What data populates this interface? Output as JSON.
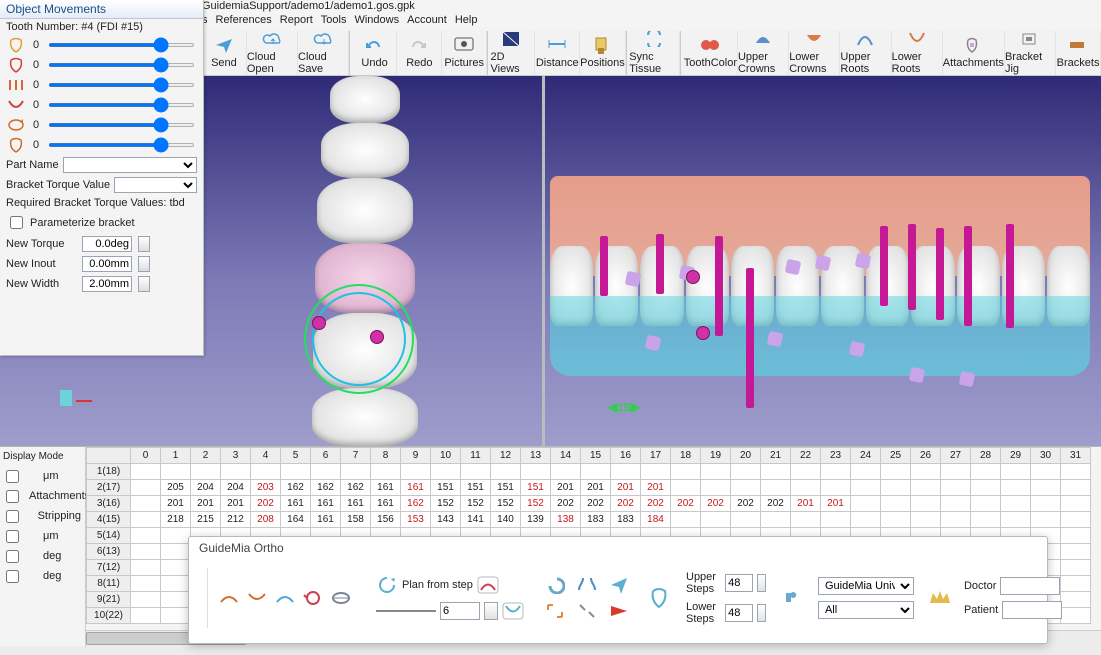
{
  "window": {
    "title_path": "GuidemiaSupport/ademo1/ademo1.gos.gpk"
  },
  "menus": [
    "s",
    "References",
    "Report",
    "Tools",
    "Windows",
    "Account",
    "Help"
  ],
  "toolbar": [
    {
      "id": "send",
      "label": "Send"
    },
    {
      "id": "cloud-open",
      "label": "Cloud Open"
    },
    {
      "id": "cloud-save",
      "label": "Cloud Save"
    },
    {
      "id": "undo",
      "label": "Undo"
    },
    {
      "id": "redo",
      "label": "Redo"
    },
    {
      "id": "pictures",
      "label": "Pictures"
    },
    {
      "id": "2d-views",
      "label": "2D Views"
    },
    {
      "id": "distance",
      "label": "Distance"
    },
    {
      "id": "positions",
      "label": "Positions"
    },
    {
      "id": "sync-tissue",
      "label": "Sync Tissue"
    },
    {
      "id": "tooth-color",
      "label": "ToothColor"
    },
    {
      "id": "upper-crowns",
      "label": "Upper Crowns"
    },
    {
      "id": "lower-crowns",
      "label": "Lower Crowns"
    },
    {
      "id": "upper-roots",
      "label": "Upper Roots"
    },
    {
      "id": "lower-roots",
      "label": "Lower Roots"
    },
    {
      "id": "attachments",
      "label": "Attachments"
    },
    {
      "id": "bracket-jig",
      "label": "Bracket Jig"
    },
    {
      "id": "brackets",
      "label": "Brackets"
    }
  ],
  "panel": {
    "title": "Object Movements",
    "tooth_number_label": "Tooth Number:",
    "tooth_number_value": "#4 (FDI #15)",
    "sliders": [
      {
        "icon": "tooth-yellow-icon",
        "value": "0"
      },
      {
        "icon": "tooth-red-icon",
        "value": "0"
      },
      {
        "icon": "teeth-roots-icon",
        "value": "0"
      },
      {
        "icon": "arch-lower-icon",
        "value": "0"
      },
      {
        "icon": "arch-rotate-icon",
        "value": "0"
      },
      {
        "icon": "tooth-outline-icon",
        "value": "0"
      }
    ],
    "part_name_label": "Part Name",
    "bracket_torque_value_label": "Bracket Torque Value",
    "required_label": "Required Bracket Torque Values:  tbd",
    "param_label": "Parameterize bracket",
    "new_torque_label": "New Torque",
    "new_torque_value": "0.0deg",
    "new_inout_label": "New Inout",
    "new_inout_value": "0.00mm",
    "new_width_label": "New Width",
    "new_width_value": "2.00mm"
  },
  "scale_gizmo": "1S",
  "grid": {
    "display_mode_label": "Display Mode",
    "left_items": [
      {
        "id": "um",
        "label": "μm",
        "icon": "arrow-orange-icon"
      },
      {
        "id": "attachments",
        "label": "Attachments",
        "icon": "tooth-icon"
      },
      {
        "id": "stripping",
        "label": "Stripping",
        "icon": "scissors-icon"
      },
      {
        "id": "um2",
        "label": "μm",
        "icon": "bracket-icon"
      },
      {
        "id": "deg",
        "label": "deg",
        "icon": "move-icon"
      },
      {
        "id": "deg2",
        "label": "deg",
        "icon": "rotate-icon"
      }
    ],
    "col_headers": [
      "0",
      "1",
      "2",
      "3",
      "4",
      "5",
      "6",
      "7",
      "8",
      "9",
      "10",
      "11",
      "12",
      "13",
      "14",
      "15",
      "16",
      "17",
      "18",
      "19",
      "20",
      "21",
      "22",
      "23",
      "24",
      "25",
      "26",
      "27",
      "28",
      "29",
      "30",
      "31"
    ],
    "row_headers": [
      "1(18)",
      "2(17)",
      "3(16)",
      "4(15)",
      "5(14)",
      "6(13)",
      "7(12)",
      "8(11)",
      "9(21)",
      "10(22)"
    ],
    "rows": [
      [],
      [
        null,
        "205",
        "204",
        "204",
        "203r",
        "162",
        "162",
        "162",
        "161",
        "161r",
        "151",
        "151",
        "151",
        "151r",
        "201",
        "201",
        "201r",
        "201r"
      ],
      [
        null,
        "201",
        "201",
        "201",
        "202r",
        "161",
        "161",
        "161",
        "161",
        "162r",
        "152",
        "152",
        "152",
        "152r",
        "202",
        "202",
        "202r",
        "202r",
        "202r",
        "202r",
        "202",
        "202",
        "201r",
        "201r"
      ],
      [
        null,
        "218",
        "215",
        "212",
        "208r",
        "164",
        "161",
        "158",
        "156",
        "153r",
        "143",
        "141",
        "140",
        "139",
        "138r",
        "183",
        "183",
        "184r"
      ],
      [],
      [],
      [],
      [],
      [],
      []
    ]
  },
  "dialog": {
    "title": "GuideMia Ortho",
    "plan_from_step_label": "Plan from step",
    "step_value": "6",
    "upper_steps_label": "Upper Steps",
    "upper_steps_value": "48",
    "lower_steps_label": "Lower Steps",
    "lower_steps_value": "48",
    "program_label": "GuideMia Universal",
    "filter_label": "All",
    "doctor_label": "Doctor",
    "doctor_value": "",
    "patient_label": "Patient",
    "patient_value": ""
  }
}
